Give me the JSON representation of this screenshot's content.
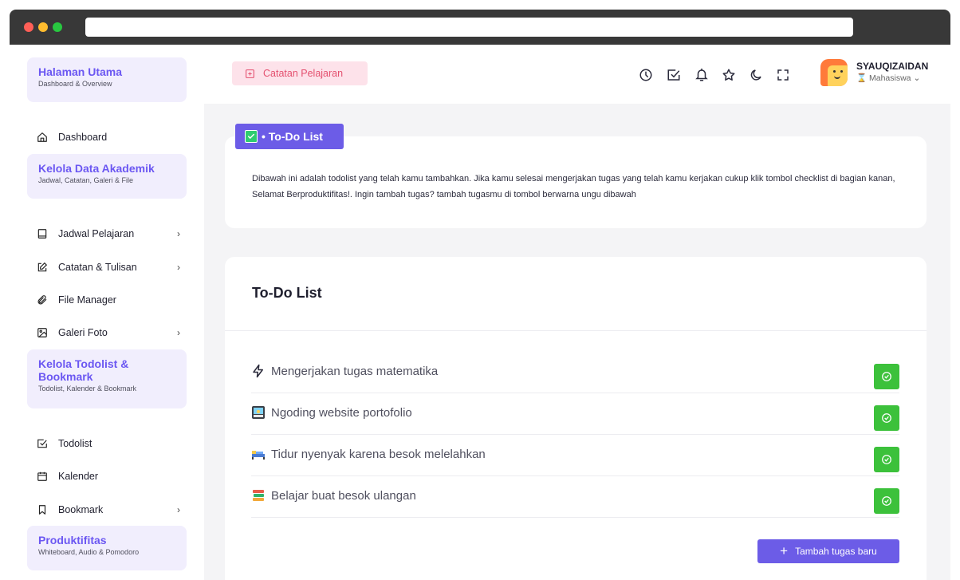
{
  "sidebar": {
    "groups": [
      {
        "title": "Halaman Utama",
        "subtitle": "Dashboard & Overview"
      },
      {
        "title": "Kelola Data Akademik",
        "subtitle": "Jadwal, Catatan, Galeri & File"
      },
      {
        "title": "Kelola Todolist & Bookmark",
        "subtitle": "Todolist, Kalender & Bookmark"
      },
      {
        "title": "Produktifitas",
        "subtitle": "Whiteboard, Audio & Pomodoro"
      }
    ],
    "items": [
      {
        "label": "Dashboard",
        "icon": "home-icon"
      },
      {
        "label": "Jadwal Pelajaran",
        "icon": "book-icon",
        "chevron": "›"
      },
      {
        "label": "Catatan & Tulisan",
        "icon": "edit-icon",
        "chevron": "›"
      },
      {
        "label": "File Manager",
        "icon": "paperclip-icon"
      },
      {
        "label": "Galeri Foto",
        "icon": "image-icon",
        "chevron": "›"
      },
      {
        "label": "Todolist",
        "icon": "checkbox-icon"
      },
      {
        "label": "Kalender",
        "icon": "calendar-icon"
      },
      {
        "label": "Bookmark",
        "icon": "bookmark-icon",
        "chevron": "›"
      }
    ]
  },
  "topbar": {
    "notes_button": "Catatan Pelajaran",
    "icons": [
      "clock-icon",
      "checkbox-icon",
      "bell-icon",
      "star-icon",
      "moon-icon",
      "fullscreen-icon"
    ],
    "user_name": "SYAUQIZAIDAN",
    "user_role": "Mahasiswa"
  },
  "intro": {
    "badge": "• To-Do List",
    "description": "Dibawah ini adalah todolist yang telah kamu tambahkan. Jika kamu selesai mengerjakan tugas yang telah kamu kerjakan cukup klik tombol checklist di bagian kanan, Selamat Berproduktifitas!. Ingin tambah tugas? tambah tugasmu di tombol berwarna ungu dibawah"
  },
  "todo": {
    "title": "To-Do List",
    "tasks": [
      {
        "text": "Mengerjakan tugas matematika",
        "icon": "lightning-icon"
      },
      {
        "text": "Ngoding website portofolio",
        "icon": "laptop-emoji-icon"
      },
      {
        "text": "Tidur nyenyak karena besok melelahkan",
        "icon": "bed-emoji-icon"
      },
      {
        "text": "Belajar buat besok ulangan",
        "icon": "books-emoji-icon"
      }
    ],
    "add_button": "Tambah tugas baru"
  },
  "colors": {
    "accent": "#6c5ce7",
    "success": "#3cc13b",
    "pink": "#e4506f"
  }
}
